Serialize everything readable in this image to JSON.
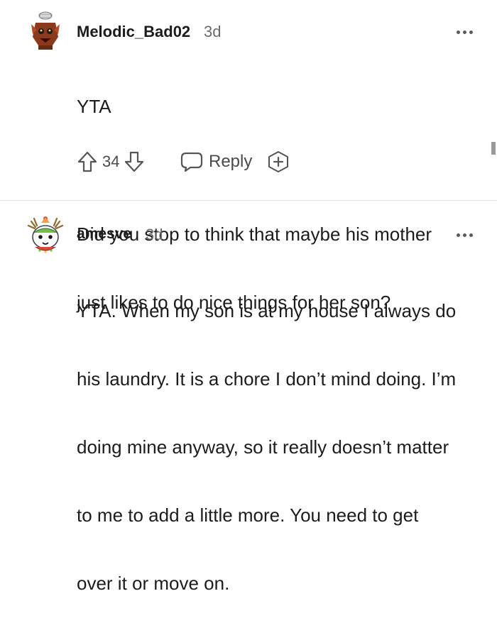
{
  "comments": [
    {
      "username": "Melodic_Bad02",
      "timestamp": "3d",
      "body_lines": [
        "YTA",
        "",
        "Did you stop to think that maybe his mother",
        "just likes to do nice things for her son?"
      ],
      "vote_count": "34",
      "reply_label": "Reply"
    },
    {
      "username": "amesve",
      "timestamp": "3d",
      "body_lines": [
        "YTA. When my son is at my house I always do",
        "his laundry. It is a chore I don’t mind doing. I’m",
        "doing mine anyway, so it really doesn’t matter",
        "to me to add a little more. You need to get",
        "over it or move on."
      ]
    }
  ],
  "icons": {
    "upvote": "arrow-up-icon",
    "downvote": "arrow-down-icon",
    "reply": "speech-bubble-icon",
    "award": "award-plus-icon",
    "more": "more-dots-icon"
  },
  "colors": {
    "text": "#1c1c1c",
    "muted": "#6b6b6b",
    "divider": "#e6e6e6"
  }
}
